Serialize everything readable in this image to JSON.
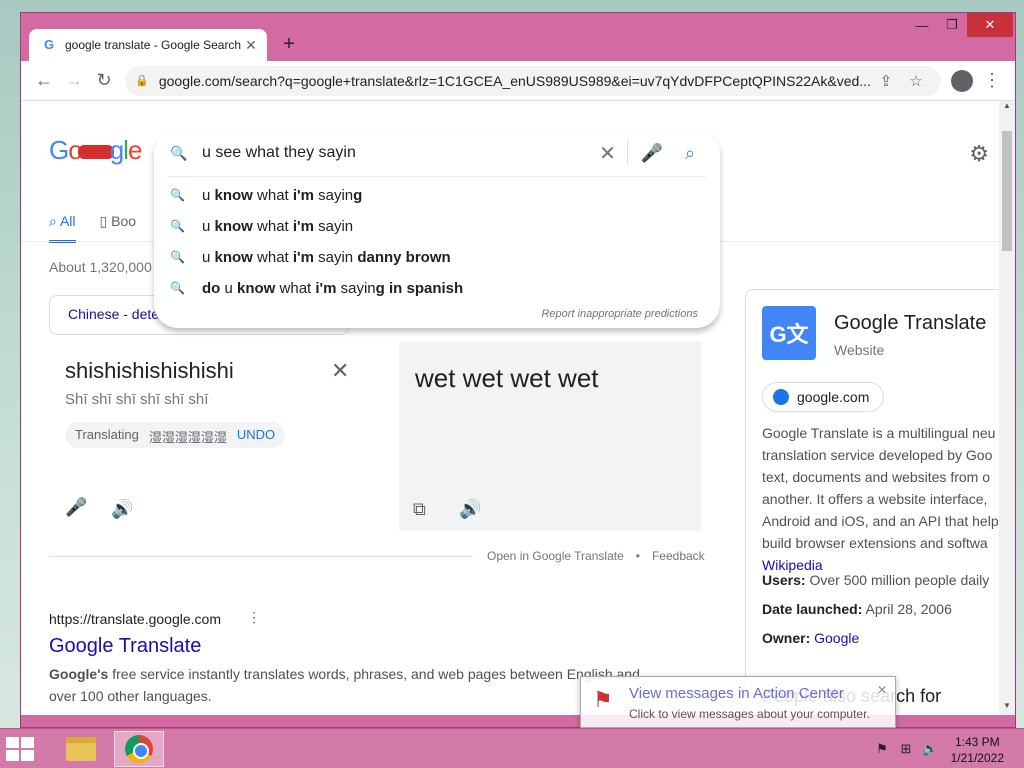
{
  "browser": {
    "tab_title": "google translate - Google Search",
    "url": "google.com/search?q=google+translate&rlz=1C1GCEA_enUS989US989&ei=uv7qYdvDFPCeptQPINS22Ak&ved..."
  },
  "search": {
    "query": "u see what they sayin",
    "suggestions": [
      {
        "html": "u <b>know</b> what <b>i'm</b> sayin<b>g</b>"
      },
      {
        "html": "u <b>know</b> what <b>i'm</b> sayin"
      },
      {
        "html": "u <b>know</b> what <b>i'm</b> sayin <b>danny brown</b>"
      },
      {
        "html": "<b>do</b> u <b>know</b> what <b>i'm</b> sayin<b>g in spanish</b>"
      }
    ],
    "report_label": "Report inappropriate predictions"
  },
  "tabs": {
    "all": "All",
    "books": "Boo"
  },
  "results_count": "About 1,320,000",
  "translate": {
    "source_lang": "Chinese - dete",
    "source_text": "shishishishishishi",
    "source_translit": "Shī shī shī shī shī shī",
    "translating_label": "Translating",
    "translating_chars": "湿湿湿湿湿湿",
    "undo_label": "UNDO",
    "target_text": "wet wet wet wet",
    "open_link": "Open in Google Translate",
    "dot": "•",
    "feedback_link": "Feedback"
  },
  "result": {
    "url": "https://translate.google.com",
    "title": "Google Translate",
    "snippet_bold": "Google's",
    "snippet": " free service instantly translates words, phrases, and web pages between English and over 100 other languages."
  },
  "knowledge_panel": {
    "title": "Google Translate",
    "subtitle": "Website",
    "site": "google.com",
    "description": "Google Translate is a multilingual neu translation service developed by Goo text, documents and websites from o another. It offers a website interface, Android and iOS, and an API that help build browser extensions and softwa",
    "wiki": "Wikipedia",
    "users_label": "Users:",
    "users_value": " Over 500 million people daily",
    "launched_label": "Date launched:",
    "launched_value": " April 28, 2006",
    "owner_label": "Owner:",
    "owner_value": "Google",
    "also_search": "People also search for"
  },
  "notification": {
    "title": "View messages in Action Center",
    "body": "Click to view messages about your computer."
  },
  "clock": {
    "time": "1:43 PM",
    "date": "1/21/2022"
  },
  "colors": {
    "frame": "#d46aa4",
    "taskbar": "#d47aa8",
    "link": "#1a0dab",
    "accent": "#1a73e8"
  }
}
